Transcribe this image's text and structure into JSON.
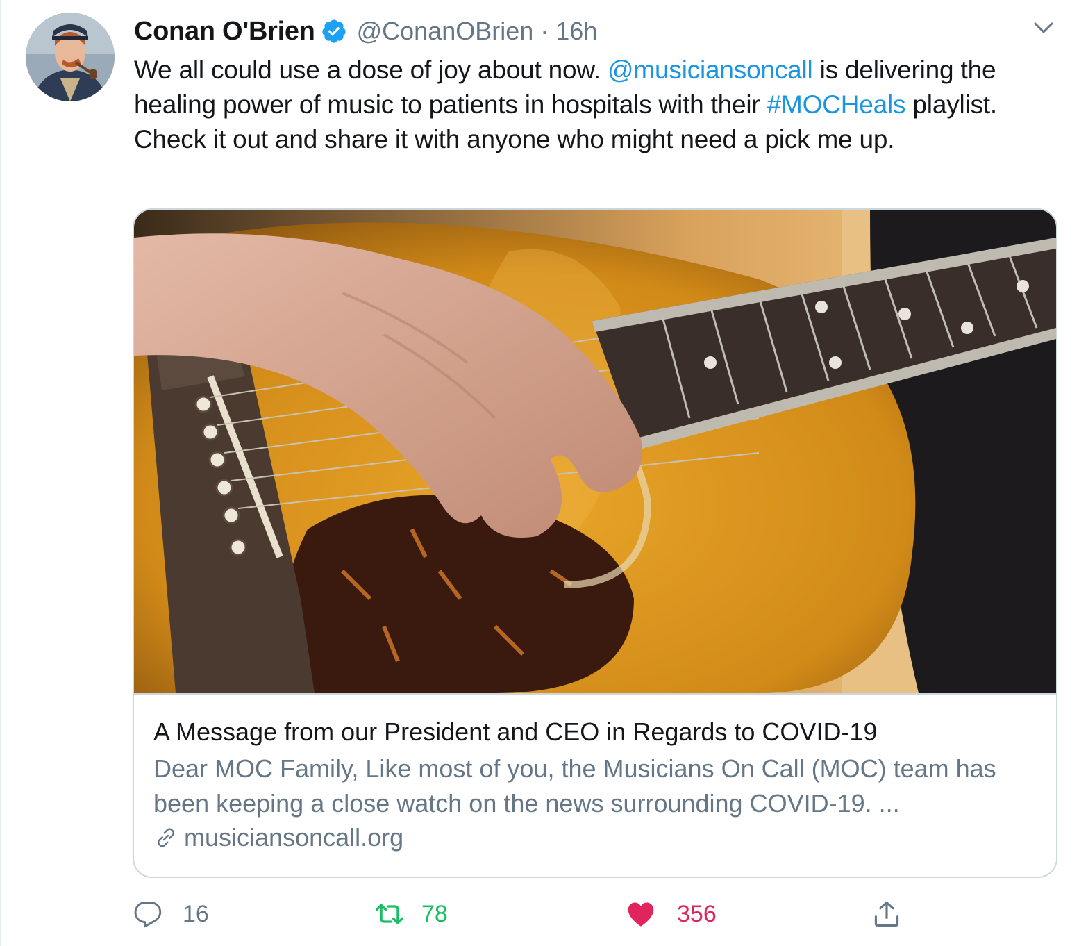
{
  "author": {
    "name": "Conan O'Brien",
    "handle": "@ConanOBrien",
    "separator": "·",
    "time": "16h"
  },
  "tweet": {
    "text_part1": "We all could use a dose of joy about now. ",
    "mention": "@musiciansoncall",
    "text_part2": " is delivering the healing power of music to patients in hospitals with their ",
    "hashtag": "#MOCHeals",
    "text_part3": " playlist. Check it out and share it with anyone who might need a pick me up."
  },
  "card": {
    "title": "A Message from our President and CEO in Regards to COVID-19",
    "description": "Dear MOC Family, Like most of you, the Musicians On Call (MOC) team has been keeping a close watch on the news surrounding COVID-19. ...",
    "url": "musiciansoncall.org"
  },
  "actions": {
    "replies": "16",
    "retweets": "78",
    "likes": "356"
  },
  "colors": {
    "link": "#1b95e0",
    "secondary_text": "#657786",
    "retweet": "#17bf63",
    "like": "#e0245e",
    "border": "#ccd6dd"
  },
  "icons": {
    "verified": "verified-badge-icon",
    "menu": "chevron-down-icon",
    "reply": "reply-icon",
    "retweet": "retweet-icon",
    "like": "heart-icon",
    "share": "share-icon",
    "link": "link-icon"
  }
}
